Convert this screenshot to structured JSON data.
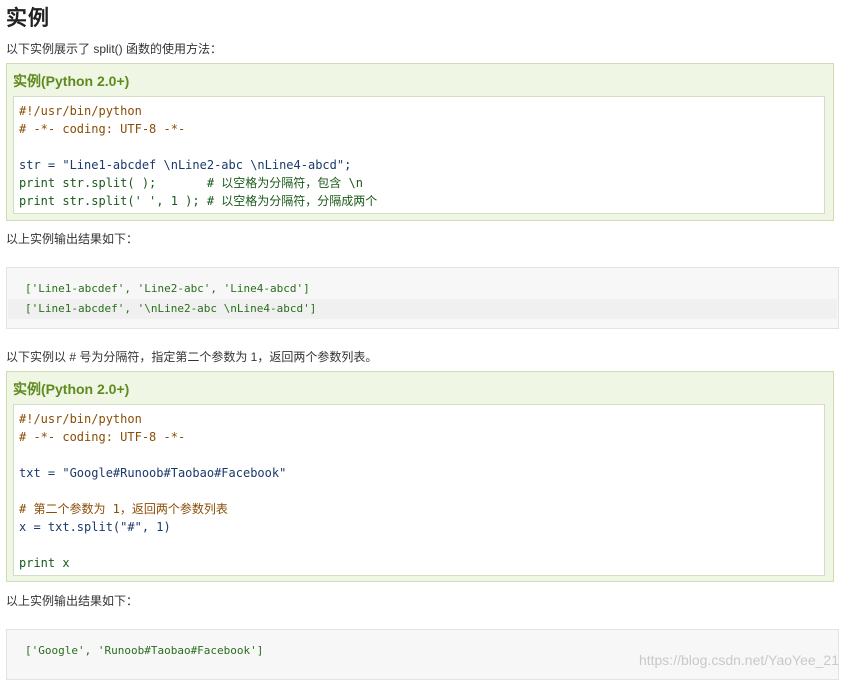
{
  "page": {
    "title": "实例",
    "intro1": "以下实例展示了 split() 函数的使用方法：",
    "result_intro1": "以上实例输出结果如下：",
    "intro2": "以下实例以 # 号为分隔符，指定第二个参数为 1，返回两个参数列表。",
    "result_intro2": "以上实例输出结果如下：",
    "watermark": "https://blog.csdn.net/YaoYee_21"
  },
  "example1": {
    "title": "实例(Python 2.0+)",
    "lines": [
      "#!/usr/bin/python",
      "# -*- coding: UTF-8 -*-",
      "",
      "str = \"Line1-abcdef \\nLine2-abc \\nLine4-abcd\";",
      "print str.split( );       # 以空格为分隔符，包含 \\n",
      "print str.split(' ', 1 ); # 以空格为分隔符，分隔成两个"
    ],
    "output": [
      "['Line1-abcdef', 'Line2-abc', 'Line4-abcd']",
      "['Line1-abcdef', '\\nLine2-abc \\nLine4-abcd']"
    ]
  },
  "example2": {
    "title": "实例(Python 2.0+)",
    "lines": [
      "#!/usr/bin/python",
      "# -*- coding: UTF-8 -*-",
      "",
      "txt = \"Google#Runoob#Taobao#Facebook\"",
      "",
      "# 第二个参数为 1，返回两个参数列表",
      "x = txt.split(\"#\", 1)",
      "",
      "print x"
    ],
    "output": [
      "['Google', 'Runoob#Taobao#Facebook']"
    ]
  },
  "colors": {
    "example_title": "#5e8a1e",
    "example_bg": "#f0f6e4",
    "comment": "#8a4d06",
    "string": "#8b1a1a",
    "output_string": "#2a6e1e"
  }
}
